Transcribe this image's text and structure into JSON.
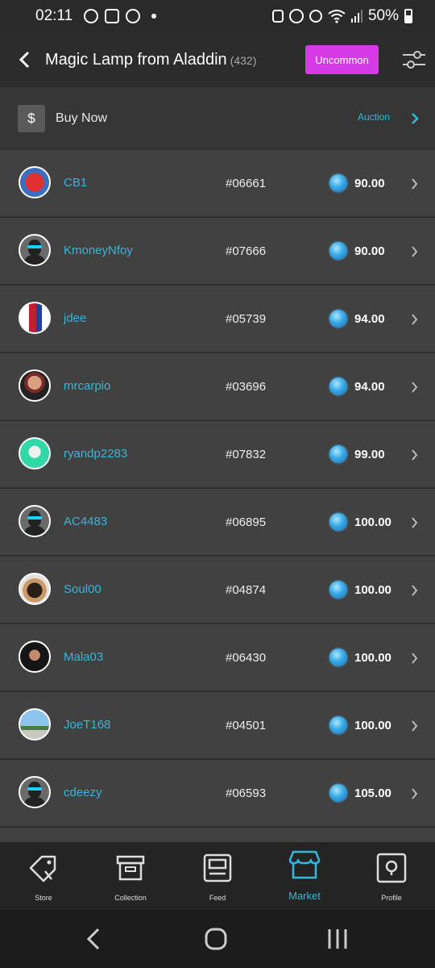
{
  "status_bar": {
    "time": "02:11",
    "battery": "50%"
  },
  "header": {
    "title": "Magic Lamp from Aladdin",
    "count": "(432)",
    "rarity": "Uncommon",
    "rarity_color": "#d63ae6"
  },
  "buy_bar": {
    "label": "Buy Now",
    "currency_symbol": "$",
    "auction_label": "Auction"
  },
  "colors": {
    "accent": "#32b8dc",
    "background": "#3a3a3a"
  },
  "listings": [
    {
      "user": "CB1",
      "serial": "#06661",
      "price": "90.00"
    },
    {
      "user": "KmoneyNfoy",
      "serial": "#07666",
      "price": "90.00"
    },
    {
      "user": "jdee",
      "serial": "#05739",
      "price": "94.00"
    },
    {
      "user": "mrcarpio",
      "serial": "#03696",
      "price": "94.00"
    },
    {
      "user": "ryandp2283",
      "serial": "#07832",
      "price": "99.00"
    },
    {
      "user": "AC4483",
      "serial": "#06895",
      "price": "100.00"
    },
    {
      "user": "Soul00",
      "serial": "#04874",
      "price": "100.00"
    },
    {
      "user": "Mala03",
      "serial": "#06430",
      "price": "100.00"
    },
    {
      "user": "JoeT168",
      "serial": "#04501",
      "price": "100.00"
    },
    {
      "user": "cdeezy",
      "serial": "#06593",
      "price": "105.00"
    }
  ],
  "bottom_nav": {
    "items": [
      {
        "label": "Store",
        "icon": "tag-icon"
      },
      {
        "label": "Collection",
        "icon": "box-icon"
      },
      {
        "label": "Feed",
        "icon": "feed-icon"
      },
      {
        "label": "Market",
        "icon": "market-icon"
      },
      {
        "label": "Profile",
        "icon": "profile-icon"
      }
    ],
    "active": "Market"
  }
}
